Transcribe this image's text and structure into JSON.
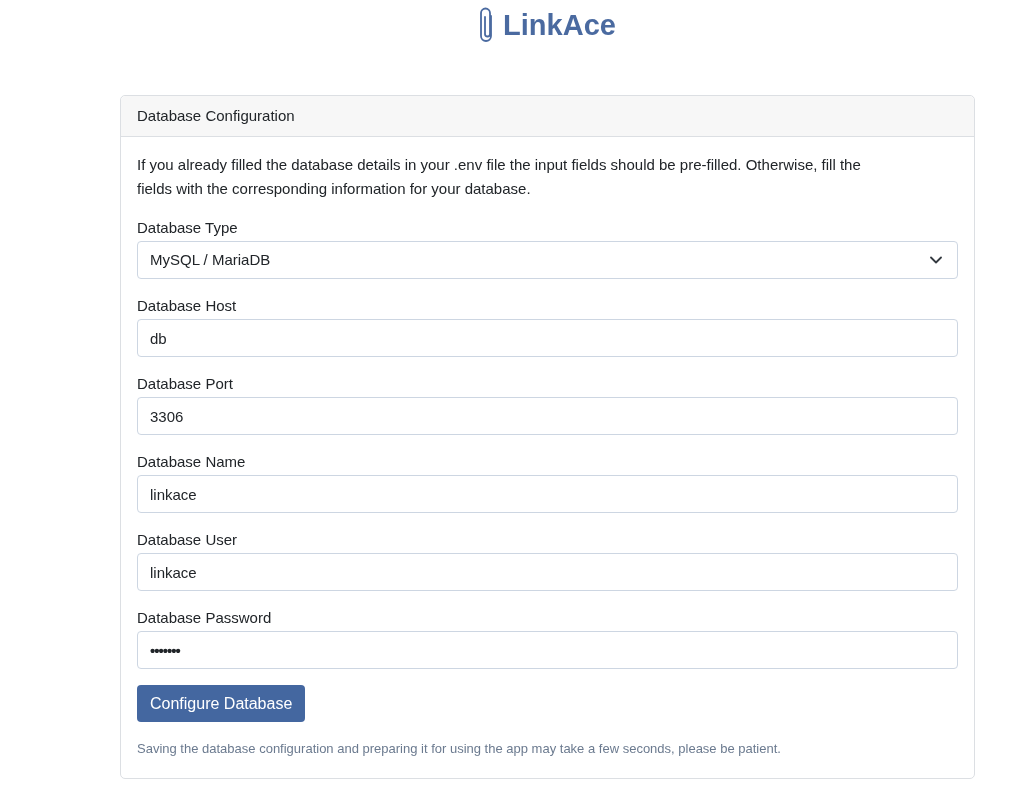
{
  "logo": {
    "text": "LinkAce"
  },
  "card": {
    "title": "Database Configuration",
    "intro": "If you already filled the database details in your .env file the input fields should be pre-filled. Otherwise, fill the fields with the corresponding information for your database.",
    "fields": [
      {
        "kind": "select",
        "label": "Database Type",
        "value": "MySQL / MariaDB"
      },
      {
        "kind": "text",
        "label": "Database Host",
        "value": "db"
      },
      {
        "kind": "text",
        "label": "Database Port",
        "value": "3306"
      },
      {
        "kind": "text",
        "label": "Database Name",
        "value": "linkace"
      },
      {
        "kind": "text",
        "label": "Database User",
        "value": "linkace"
      },
      {
        "kind": "password",
        "label": "Database Password",
        "value": "•••••••"
      }
    ],
    "submit": "Configure Database",
    "note": "Saving the database configuration and preparing it for using the app may take a few seconds, please be patient."
  }
}
